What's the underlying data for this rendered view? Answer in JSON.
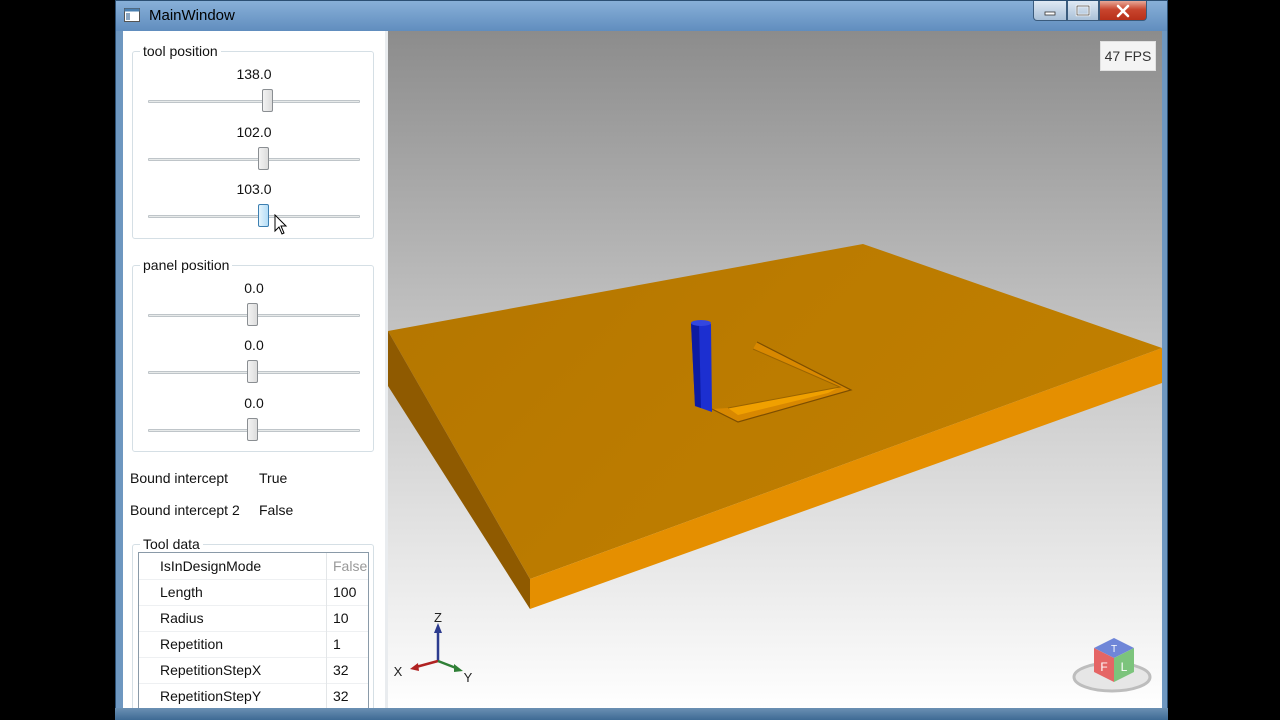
{
  "window": {
    "title": "MainWindow",
    "icon": "app-window-icon"
  },
  "tool_position": {
    "label": "tool position",
    "sliders": [
      {
        "value": "138.0",
        "level": 0.56
      },
      {
        "value": "102.0",
        "level": 0.54
      },
      {
        "value": "103.0",
        "level": 0.54
      }
    ]
  },
  "panel_position": {
    "label": "panel position",
    "sliders": [
      {
        "value": "0.0",
        "level": 0.5
      },
      {
        "value": "0.0",
        "level": 0.5
      },
      {
        "value": "0.0",
        "level": 0.5
      }
    ]
  },
  "bound_intercept": {
    "label": "Bound intercept",
    "value": "True"
  },
  "bound_intercept_2": {
    "label": "Bound intercept 2",
    "value": "False"
  },
  "tool_data": {
    "label": "Tool data",
    "rows": [
      {
        "name": "IsInDesignMode",
        "value": "False"
      },
      {
        "name": "Length",
        "value": "100"
      },
      {
        "name": "Radius",
        "value": "10"
      },
      {
        "name": "Repetition",
        "value": "1"
      },
      {
        "name": "RepetitionStepX",
        "value": "32"
      },
      {
        "name": "RepetitionStepY",
        "value": "32"
      }
    ]
  },
  "viewport": {
    "fps": "47 FPS",
    "axes": {
      "z": "Z",
      "x": "X",
      "y": "Y"
    },
    "view_cube": {
      "left": "F",
      "right": "L",
      "top": "T"
    },
    "colors": {
      "panel": "#b97a00",
      "tool": "#1c2fd0",
      "axis_z": "#2d3c8f",
      "axis_x": "#b02222",
      "axis_y": "#2f7f36"
    }
  }
}
